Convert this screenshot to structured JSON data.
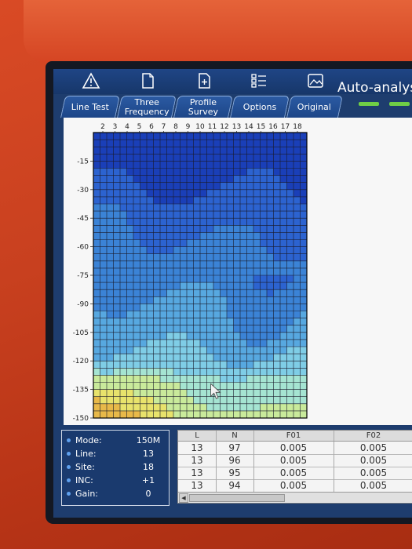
{
  "app": {
    "title": "Auto-analysis"
  },
  "toolbar": {
    "icons": [
      "warning-icon",
      "document-icon",
      "new-document-icon",
      "list-icon",
      "image-icon"
    ]
  },
  "tabs": [
    {
      "label": "Line Test"
    },
    {
      "label": "Three\nFrequency"
    },
    {
      "label": "Profile\nSurvey"
    },
    {
      "label": "Options"
    },
    {
      "label": "Original"
    }
  ],
  "chart_data": {
    "type": "heatmap",
    "title": "",
    "xlabel": "",
    "ylabel": "",
    "x_ticks": [
      "2",
      "3",
      "4",
      "5",
      "6",
      "7",
      "8",
      "9",
      "10",
      "11",
      "12",
      "13",
      "14",
      "15",
      "16",
      "17",
      "18"
    ],
    "y_ticks": [
      "-15",
      "-30",
      "-45",
      "-60",
      "-75",
      "-90",
      "-105",
      "-120",
      "-135",
      "-150"
    ],
    "xlim": [
      2,
      18
    ],
    "ylim": [
      -150,
      0
    ],
    "grid": true,
    "colorscale": [
      "#1a3fb8",
      "#2c63d0",
      "#3b83d6",
      "#57a8e0",
      "#7fcde6",
      "#a5e4d2",
      "#c9ea9b",
      "#e8e36c",
      "#e8b949"
    ]
  },
  "params": {
    "mode": {
      "label": "Mode:",
      "value": "150M"
    },
    "line": {
      "label": "Line:",
      "value": "13"
    },
    "site": {
      "label": "Site:",
      "value": "18"
    },
    "inc": {
      "label": "INC:",
      "value": "+1"
    },
    "gain": {
      "label": "Gain:",
      "value": "0"
    }
  },
  "table": {
    "headers": [
      "L",
      "N",
      "F01",
      "F02"
    ],
    "rows": [
      [
        "13",
        "97",
        "0.005",
        "0.005"
      ],
      [
        "13",
        "96",
        "0.005",
        "0.005"
      ],
      [
        "13",
        "95",
        "0.005",
        "0.005"
      ],
      [
        "13",
        "94",
        "0.005",
        "0.005"
      ]
    ]
  }
}
